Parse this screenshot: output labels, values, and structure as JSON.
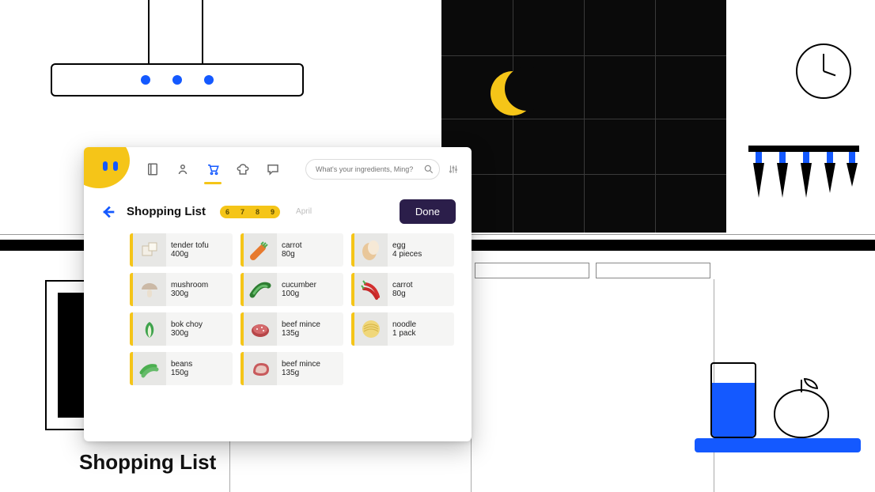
{
  "caption": "Shopping List",
  "colors": {
    "accent": "#1459ff",
    "brand": "#f5c518",
    "done_bg": "#2b1e4a"
  },
  "nav": {
    "icons": [
      "book-icon",
      "profile-icon",
      "cart-icon",
      "chef-hat-icon",
      "chat-icon"
    ],
    "active": "cart-icon"
  },
  "search": {
    "placeholder": "What's your ingredients, Ming?"
  },
  "header": {
    "back_label": "Back",
    "title": "Shopping List",
    "dates": [
      "6",
      "7",
      "8",
      "9"
    ],
    "month": "April",
    "done_label": "Done"
  },
  "items": [
    {
      "name": "tender tofu",
      "qty": "400g",
      "icon": "tofu"
    },
    {
      "name": "carrot",
      "qty": "80g",
      "icon": "carrot"
    },
    {
      "name": "egg",
      "qty": "4 pieces",
      "icon": "egg"
    },
    {
      "name": "mushroom",
      "qty": "300g",
      "icon": "mushroom"
    },
    {
      "name": "cucumber",
      "qty": "100g",
      "icon": "cucumber"
    },
    {
      "name": "carrot",
      "qty": "80g",
      "icon": "chili"
    },
    {
      "name": "bok choy",
      "qty": "300g",
      "icon": "bokchoy"
    },
    {
      "name": "beef mince",
      "qty": "135g",
      "icon": "mince"
    },
    {
      "name": "noodle",
      "qty": "1 pack",
      "icon": "noodle"
    },
    {
      "name": "beans",
      "qty": "150g",
      "icon": "beans"
    },
    {
      "name": "beef mince",
      "qty": "135g",
      "icon": "steak"
    }
  ]
}
